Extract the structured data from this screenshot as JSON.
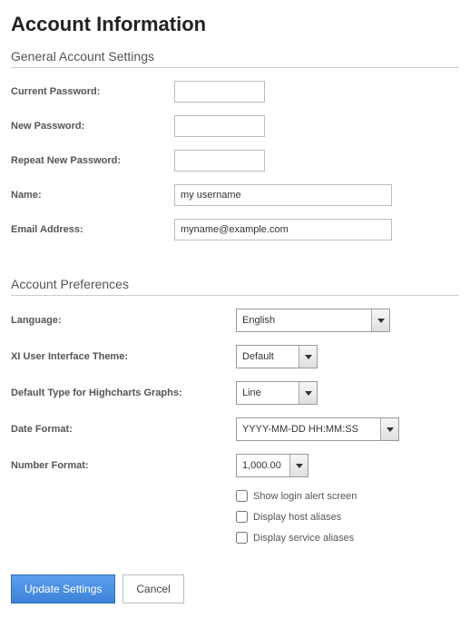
{
  "page_title": "Account Information",
  "general": {
    "title": "General Account Settings",
    "current_password_label": "Current Password:",
    "current_password_value": "",
    "new_password_label": "New Password:",
    "new_password_value": "",
    "repeat_password_label": "Repeat New Password:",
    "repeat_password_value": "",
    "name_label": "Name:",
    "name_value": "my username",
    "email_label": "Email Address:",
    "email_value": "myname@example.com"
  },
  "prefs": {
    "title": "Account Preferences",
    "language_label": "Language:",
    "language_value": "English",
    "theme_label": "XI User Interface Theme:",
    "theme_value": "Default",
    "chart_label": "Default Type for Highcharts Graphs:",
    "chart_value": "Line",
    "date_label": "Date Format:",
    "date_value": "YYYY-MM-DD HH:MM:SS",
    "num_label": "Number Format:",
    "num_value": "1,000.00",
    "cb_login_alert": "Show login alert screen",
    "cb_host_aliases": "Display host aliases",
    "cb_service_aliases": "Display service aliases"
  },
  "buttons": {
    "update": "Update Settings",
    "cancel": "Cancel"
  }
}
